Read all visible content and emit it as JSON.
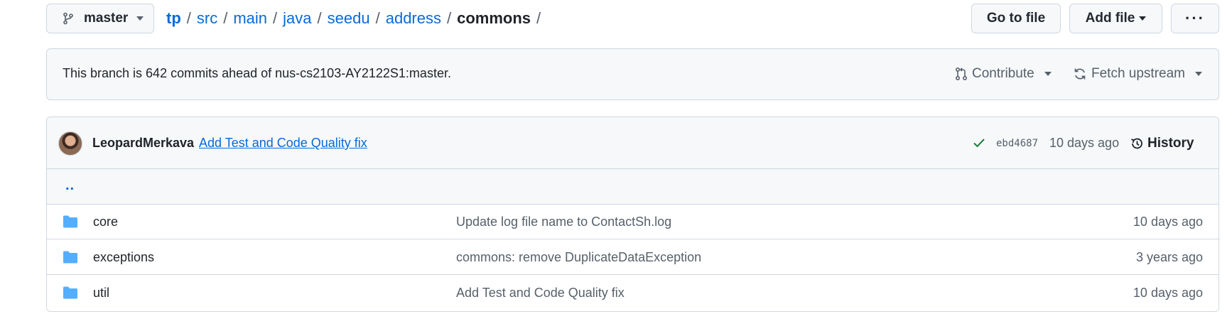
{
  "branch": {
    "name": "master"
  },
  "breadcrumb": {
    "root": "tp",
    "parts": [
      "src",
      "main",
      "java",
      "seedu",
      "address"
    ],
    "current": "commons",
    "separator": "/"
  },
  "toolbar": {
    "goto_label": "Go to file",
    "add_label": "Add file",
    "more_label": "···"
  },
  "branch_info": {
    "text": "This branch is 642 commits ahead of nus-cs2103-AY2122S1:master.",
    "contribute_label": "Contribute",
    "fetch_label": "Fetch upstream"
  },
  "latest_commit": {
    "author": "LeopardMerkava",
    "message": "Add Test and Code Quality fix",
    "sha": "ebd4687",
    "age": "10 days ago",
    "history_label": "History",
    "status_color": "#1a7f37"
  },
  "parent_link": "..",
  "files": [
    {
      "name": "core",
      "message": "Update log file name to ContactSh.log",
      "age": "10 days ago",
      "icon": "folder-icon"
    },
    {
      "name": "exceptions",
      "message": "commons: remove DuplicateDataException",
      "age": "3 years ago",
      "icon": "folder-icon"
    },
    {
      "name": "util",
      "message": "Add Test and Code Quality fix",
      "age": "10 days ago",
      "icon": "folder-icon"
    }
  ],
  "colors": {
    "link": "#0969da",
    "folder": "#54aeff",
    "border": "#d0d7de",
    "muted": "#57606a"
  }
}
